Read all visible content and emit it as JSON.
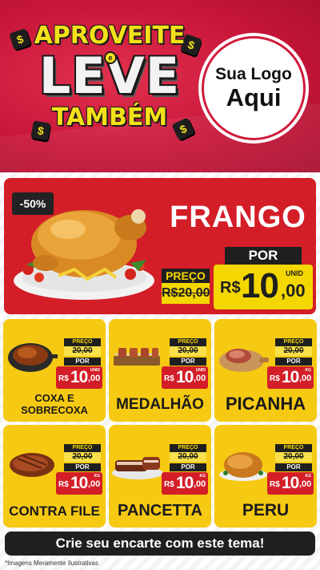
{
  "header": {
    "promo_line1": "APROVEITE",
    "promo_connector": "e",
    "promo_line2": "LEVE",
    "promo_line3": "TAMBÉM",
    "coin_symbol": "$",
    "logo_line1": "Sua Logo",
    "logo_line2": "Aqui"
  },
  "featured": {
    "discount": "-50%",
    "name": "FRANGO",
    "price_label": "PREÇO",
    "old_price": "R$20,00",
    "por_label": "POR",
    "unit": "UNID",
    "currency": "R$",
    "new_price_int": "10",
    "new_price_cents": ",00",
    "image": "roast-chicken-platter"
  },
  "products": [
    {
      "name_line1": "COXA E",
      "name_line2": "SOBRECOXA",
      "price_label": "PREÇO",
      "old_price": "20,00",
      "por_label": "POR",
      "currency": "R$",
      "new_price_int": "10",
      "new_price_cents": ",00",
      "unit": "UNID",
      "image": "chicken-leg-pan"
    },
    {
      "name_line1": "MEDALHÃO",
      "name_line2": "",
      "price_label": "PREÇO",
      "old_price": "20,00",
      "por_label": "POR",
      "currency": "R$",
      "new_price_int": "10",
      "new_price_cents": ",00",
      "unit": "UNID",
      "image": "medallion-skewers"
    },
    {
      "name_line1": "PICANHA",
      "name_line2": "",
      "price_label": "PREÇO",
      "old_price": "20,00",
      "por_label": "POR",
      "currency": "R$",
      "new_price_int": "10",
      "new_price_cents": ",00",
      "unit": "KG",
      "image": "picanha-board"
    },
    {
      "name_line1": "CONTRA FILE",
      "name_line2": "",
      "price_label": "PREÇO",
      "old_price": "20,00",
      "por_label": "POR",
      "currency": "R$",
      "new_price_int": "10",
      "new_price_cents": ",00",
      "unit": "KG",
      "image": "steak"
    },
    {
      "name_line1": "PANCETTA",
      "name_line2": "",
      "price_label": "PREÇO",
      "old_price": "20,00",
      "por_label": "POR",
      "currency": "R$",
      "new_price_int": "10",
      "new_price_cents": ",00",
      "unit": "KG",
      "image": "pancetta-slices"
    },
    {
      "name_line1": "PERU",
      "name_line2": "",
      "price_label": "PREÇO",
      "old_price": "20,00",
      "por_label": "POR",
      "currency": "R$",
      "new_price_int": "10",
      "new_price_cents": ",00",
      "unit": "KG",
      "image": "roast-turkey"
    }
  ],
  "footer": {
    "cta": "Crie seu encarte com este tema!",
    "disclaimer": "*Imagens Meramente Ilustrativas"
  },
  "colors": {
    "header_red": "#c8163a",
    "card_red": "#d31e28",
    "card_yellow": "#f6c912",
    "price_yellow": "#f4d700",
    "dark": "#1f1f1f"
  }
}
